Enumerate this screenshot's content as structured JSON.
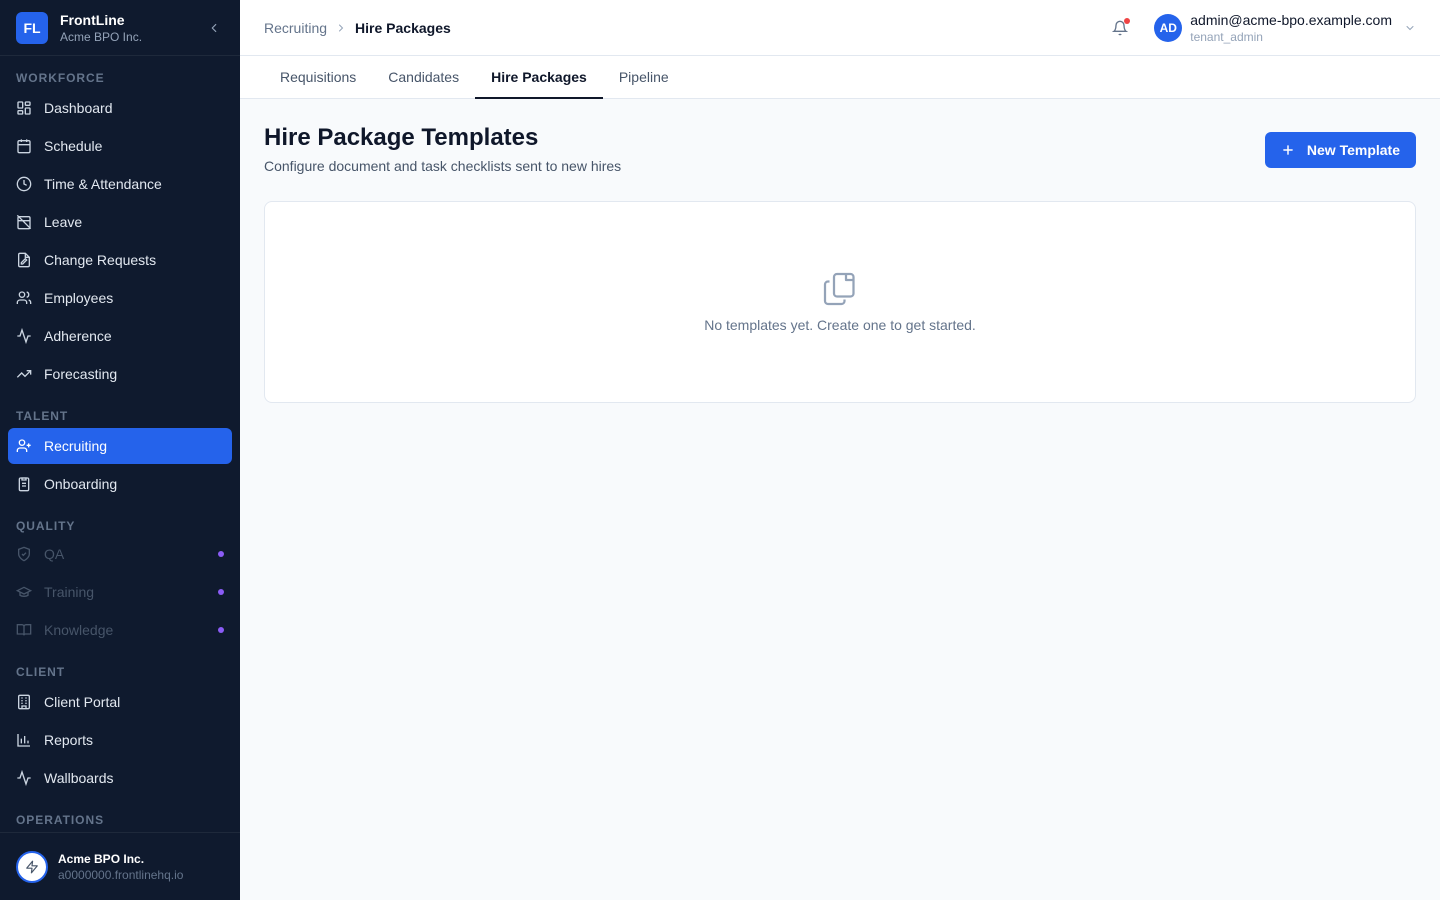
{
  "brand": {
    "initials": "FL",
    "name": "FrontLine",
    "org": "Acme BPO Inc."
  },
  "sidebar": {
    "sections": [
      {
        "label": "WORKFORCE",
        "items": [
          {
            "label": "Dashboard",
            "icon": "dashboard-icon"
          },
          {
            "label": "Schedule",
            "icon": "calendar-icon"
          },
          {
            "label": "Time & Attendance",
            "icon": "clock-icon"
          },
          {
            "label": "Leave",
            "icon": "calendar-off-icon"
          },
          {
            "label": "Change Requests",
            "icon": "file-edit-icon"
          },
          {
            "label": "Employees",
            "icon": "users-icon"
          },
          {
            "label": "Adherence",
            "icon": "activity-icon"
          },
          {
            "label": "Forecasting",
            "icon": "trending-up-icon"
          }
        ]
      },
      {
        "label": "TALENT",
        "items": [
          {
            "label": "Recruiting",
            "icon": "user-plus-icon",
            "active": true
          },
          {
            "label": "Onboarding",
            "icon": "clipboard-icon"
          }
        ]
      },
      {
        "label": "QUALITY",
        "items": [
          {
            "label": "QA",
            "icon": "shield-icon",
            "disabled": true
          },
          {
            "label": "Training",
            "icon": "graduation-cap-icon",
            "disabled": true
          },
          {
            "label": "Knowledge",
            "icon": "book-icon",
            "disabled": true
          }
        ]
      },
      {
        "label": "CLIENT",
        "items": [
          {
            "label": "Client Portal",
            "icon": "building-icon"
          },
          {
            "label": "Reports",
            "icon": "bar-chart-icon"
          },
          {
            "label": "Wallboards",
            "icon": "activity-icon"
          }
        ]
      },
      {
        "label": "OPERATIONS",
        "items": []
      }
    ],
    "footer": {
      "name": "Acme BPO Inc.",
      "domain": "a0000000.frontlinehq.io"
    }
  },
  "topbar": {
    "breadcrumb": [
      "Recruiting",
      "Hire Packages"
    ],
    "user": {
      "initials": "AD",
      "email": "admin@acme-bpo.example.com",
      "role": "tenant_admin"
    }
  },
  "tabs": [
    {
      "label": "Requisitions"
    },
    {
      "label": "Candidates"
    },
    {
      "label": "Hire Packages",
      "active": true
    },
    {
      "label": "Pipeline"
    }
  ],
  "main": {
    "title": "Hire Package Templates",
    "subtitle": "Configure document and task checklists sent to new hires",
    "new_button": "New Template",
    "empty_text": "No templates yet. Create one to get started."
  },
  "colors": {
    "accent": "#2563eb",
    "sidebar_bg": "#0f1a2e",
    "badge_dot": "#8b5cf6",
    "notification": "#ef4444"
  }
}
